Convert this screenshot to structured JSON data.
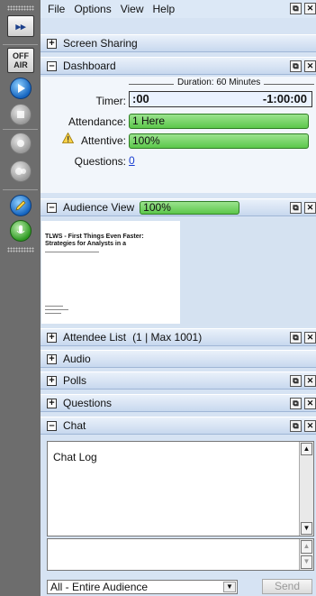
{
  "menu": [
    "File",
    "Options",
    "View",
    "Help"
  ],
  "panes": {
    "screen_sharing": "Screen Sharing",
    "dashboard": "Dashboard",
    "audience_view": "Audience View",
    "attendee_list": "Attendee List",
    "attendee_count": "(1 | Max 1001)",
    "audio": "Audio",
    "polls": "Polls",
    "questions": "Questions",
    "chat": "Chat"
  },
  "dashboard": {
    "duration": "Duration: 60 Minutes",
    "timer_label": "Timer:",
    "timer_left": ":00",
    "timer_right": "-1:00:00",
    "attendance_label": "Attendance:",
    "attendance_value": "1 Here",
    "attentive_label": "Attentive:",
    "attentive_value": "100%",
    "questions_label": "Questions:",
    "questions_value": "0"
  },
  "audience_view": {
    "attentive_value": "100%",
    "slide_title": "TLWS - First Things Even Faster: Strategies for Analysts in a"
  },
  "toolbar": {
    "offair": [
      "OFF",
      "AIR"
    ],
    "collapse": "▸▸"
  },
  "chat": {
    "log_label": "Chat Log",
    "audience_option": "All - Entire Audience",
    "send_label": "Send"
  },
  "colors": {
    "panel": "#d6e3f3",
    "accent_green": "#5cc74b",
    "toolbar": "#6d6d6d"
  },
  "icons": {
    "toolbar": [
      "grip",
      "expand-arrows",
      "off-air",
      "play",
      "stop",
      "record",
      "webcam",
      "pencil",
      "microphone",
      "grip"
    ]
  }
}
